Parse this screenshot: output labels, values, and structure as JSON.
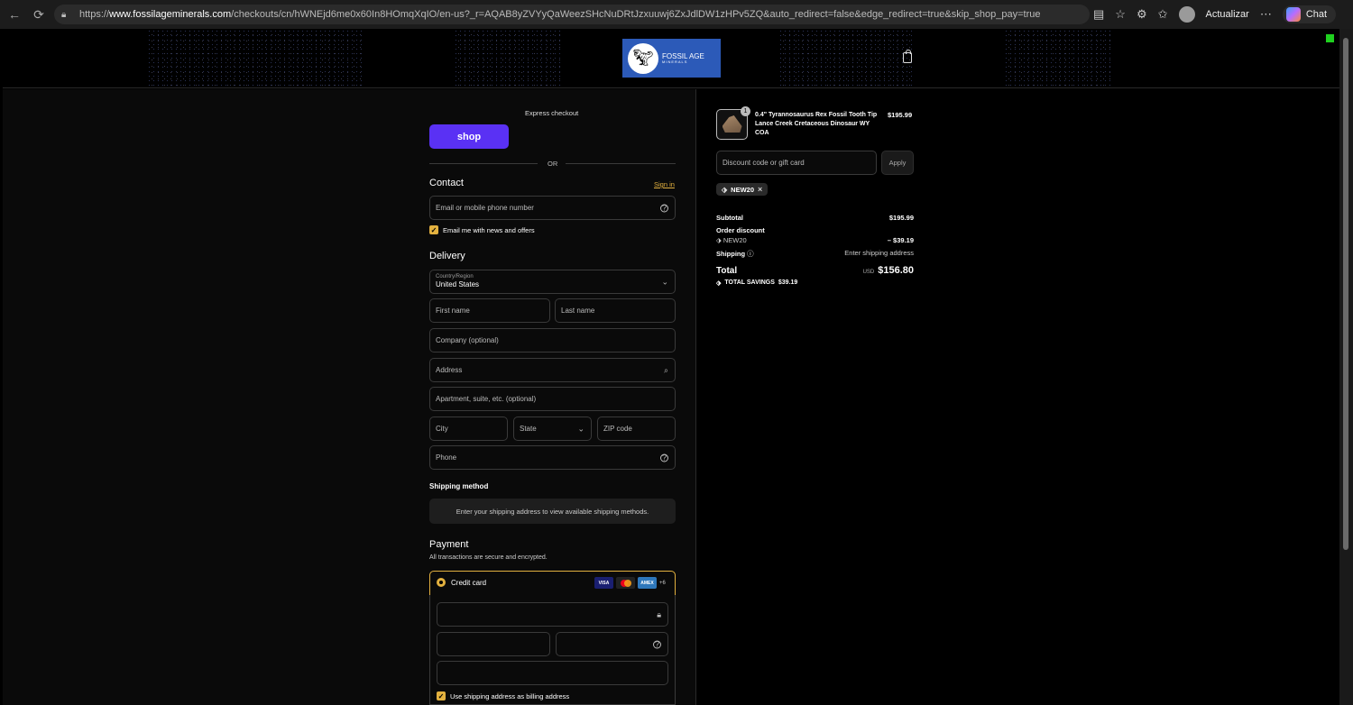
{
  "browser": {
    "url_prefix": "https://",
    "url_domain": "www.fossilageminerals.com",
    "url_path": "/checkouts/cn/hWNEjd6me0x60In8HOmqXqIO/en-us?_r=AQAB8yZVYyQaWeezSHcNuDRtJzxuuwj6ZxJdlDW1zHPv5ZQ&auto_redirect=false&edge_redirect=true&skip_shop_pay=true",
    "update_label": "Actualizar",
    "chat_label": "Chat"
  },
  "header": {
    "logo_line1": "FOSSIL AGE",
    "logo_line2": "MINERALS"
  },
  "checkout": {
    "express_label": "Express checkout",
    "shop_label": "shop",
    "or_label": "OR",
    "contact_title": "Contact",
    "sign_in": "Sign in",
    "email_placeholder": "Email or mobile phone number",
    "email_news": "Email me with news and offers",
    "delivery_title": "Delivery",
    "country_label": "Country/Region",
    "country_value": "United States",
    "first_name": "First name",
    "last_name": "Last name",
    "company": "Company (optional)",
    "address": "Address",
    "apartment": "Apartment, suite, etc. (optional)",
    "city": "City",
    "state": "State",
    "zip": "ZIP code",
    "phone": "Phone",
    "shipping_method_title": "Shipping method",
    "shipping_notice": "Enter your shipping address to view available shipping methods.",
    "payment_title": "Payment",
    "payment_sub": "All transactions are secure and encrypted.",
    "credit_card": "Credit card",
    "card_visa": "VISA",
    "card_amex": "AMEX",
    "card_more": "+6",
    "billing_same": "Use shipping address as billing address"
  },
  "summary": {
    "item_name": "0.4\" Tyrannosaurus Rex Fossil Tooth Tip Lance Creek Cretaceous Dinosaur WY COA",
    "item_price": "$195.99",
    "item_qty": "1",
    "discount_placeholder": "Discount code or gift card",
    "apply": "Apply",
    "applied_code": "NEW20",
    "subtotal_label": "Subtotal",
    "subtotal_value": "$195.99",
    "order_discount_label": "Order discount",
    "discount_code": "NEW20",
    "discount_value": "– $39.19",
    "shipping_label": "Shipping",
    "shipping_value": "Enter shipping address",
    "total_label": "Total",
    "currency": "USD",
    "total_value": "$156.80",
    "savings_label": "TOTAL SAVINGS",
    "savings_value": "$39.19"
  },
  "colors": {
    "accent": "#e3b13f",
    "shop_purple": "#5a31f4",
    "logo_blue": "#2c5ab8"
  }
}
